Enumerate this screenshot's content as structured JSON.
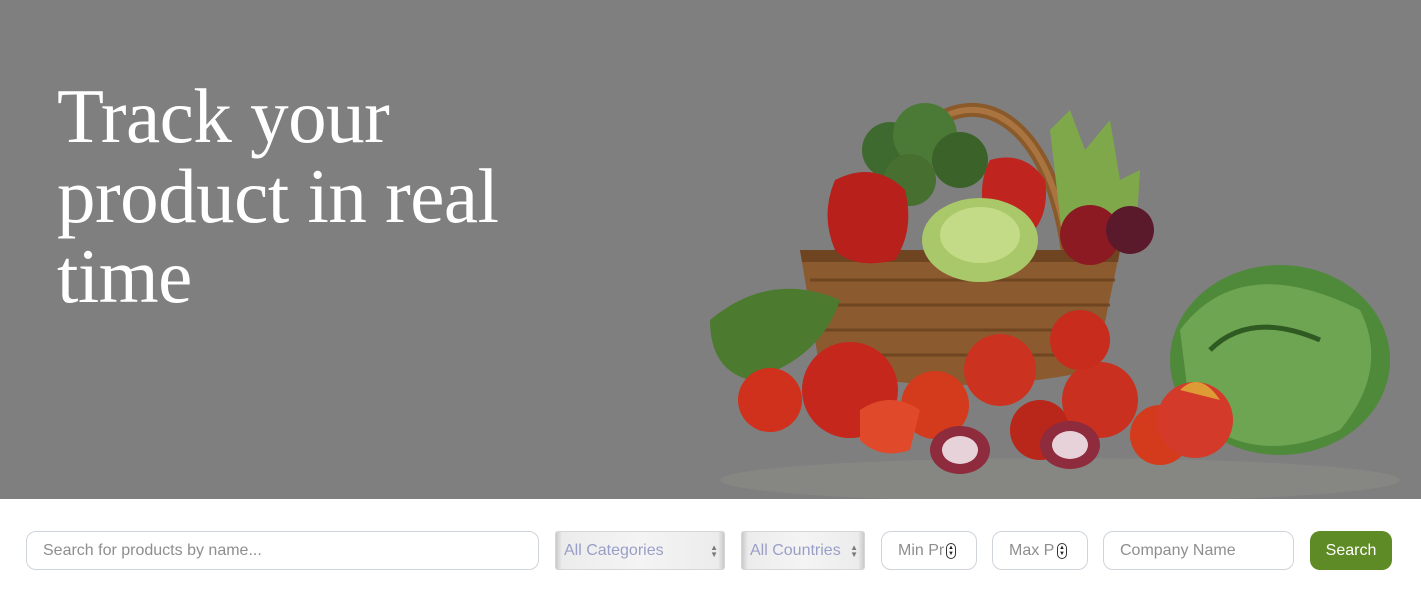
{
  "hero": {
    "title": "Track your product in real time",
    "image_description_icon": "vegetable-basket-image"
  },
  "search": {
    "name_placeholder": "Search for products by name...",
    "category_selected": "All Categories",
    "country_selected": "All Countries",
    "min_price_placeholder": "Min Price",
    "max_price_placeholder": "Max Price",
    "company_placeholder": "Company Name",
    "button_label": "Search",
    "button_color": "#5e8b25"
  }
}
